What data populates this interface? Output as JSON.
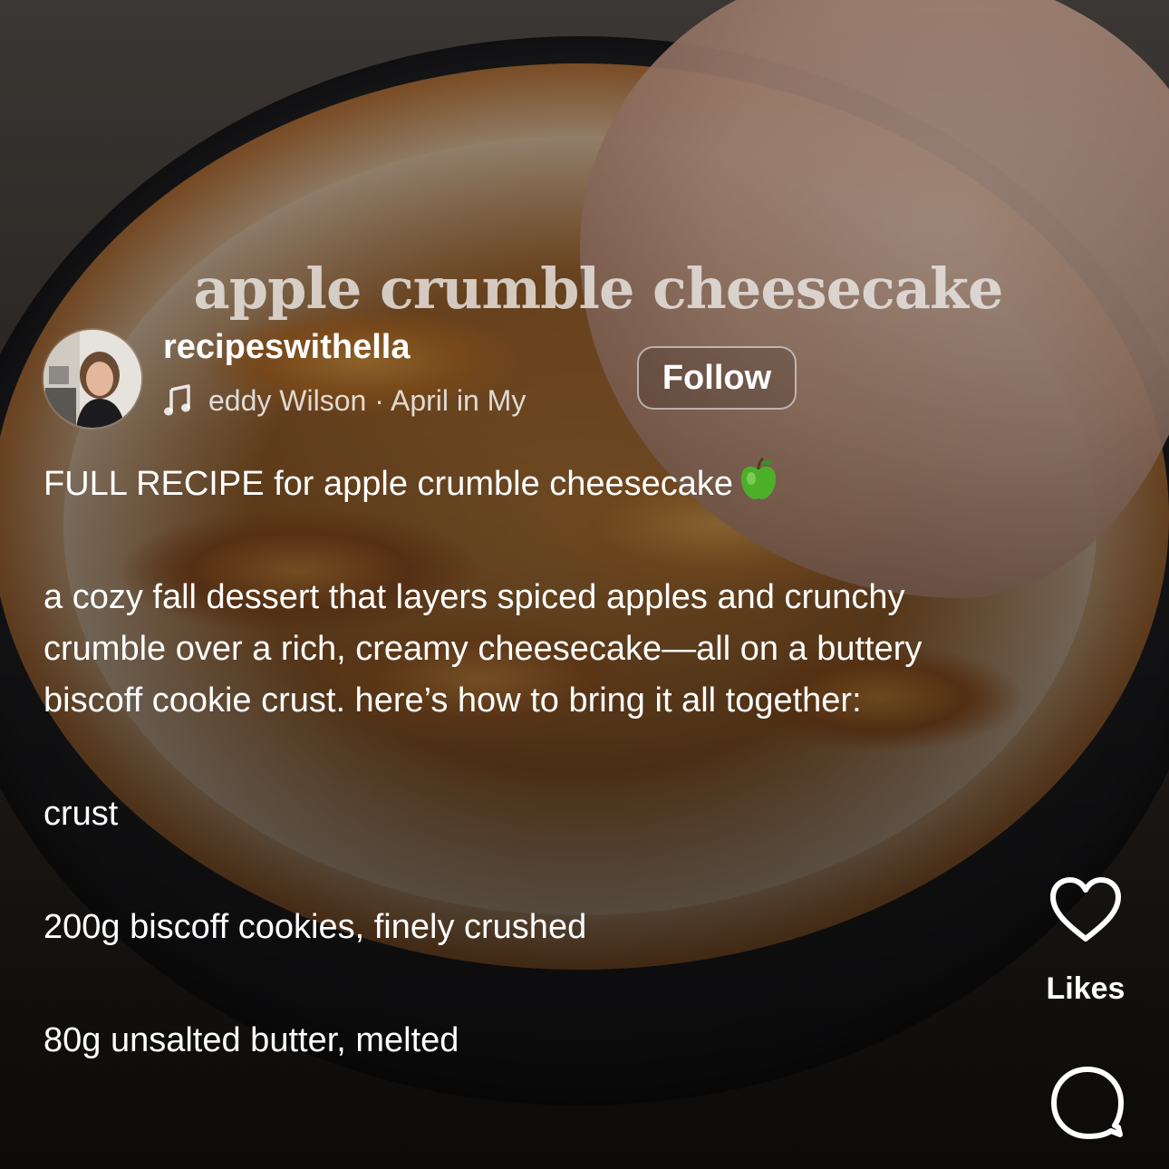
{
  "video": {
    "overlay_title": "apple crumble cheesecake"
  },
  "author": {
    "username": "recipeswithella",
    "audio": "eddy Wilson · April in My"
  },
  "follow_label": "Follow",
  "caption": {
    "lines": [
      "FULL RECIPE for apple crumble cheesecake",
      "a cozy fall dessert that layers spiced apples and crunchy crumble over a rich, creamy cheesecake—all on a buttery biscoff cookie crust. here’s how to bring it all together:",
      "crust",
      "200g biscoff cookies, finely crushed",
      "80g unsalted butter, melted"
    ],
    "title_emoji": "green-apple-icon"
  },
  "actions": {
    "likes_label": "Likes",
    "like_icon": "heart-icon",
    "comment_icon": "comment-icon"
  },
  "colors": {
    "text": "#ffffff",
    "follow_border": "#ffffff",
    "apple_green": "#4caf2a"
  }
}
